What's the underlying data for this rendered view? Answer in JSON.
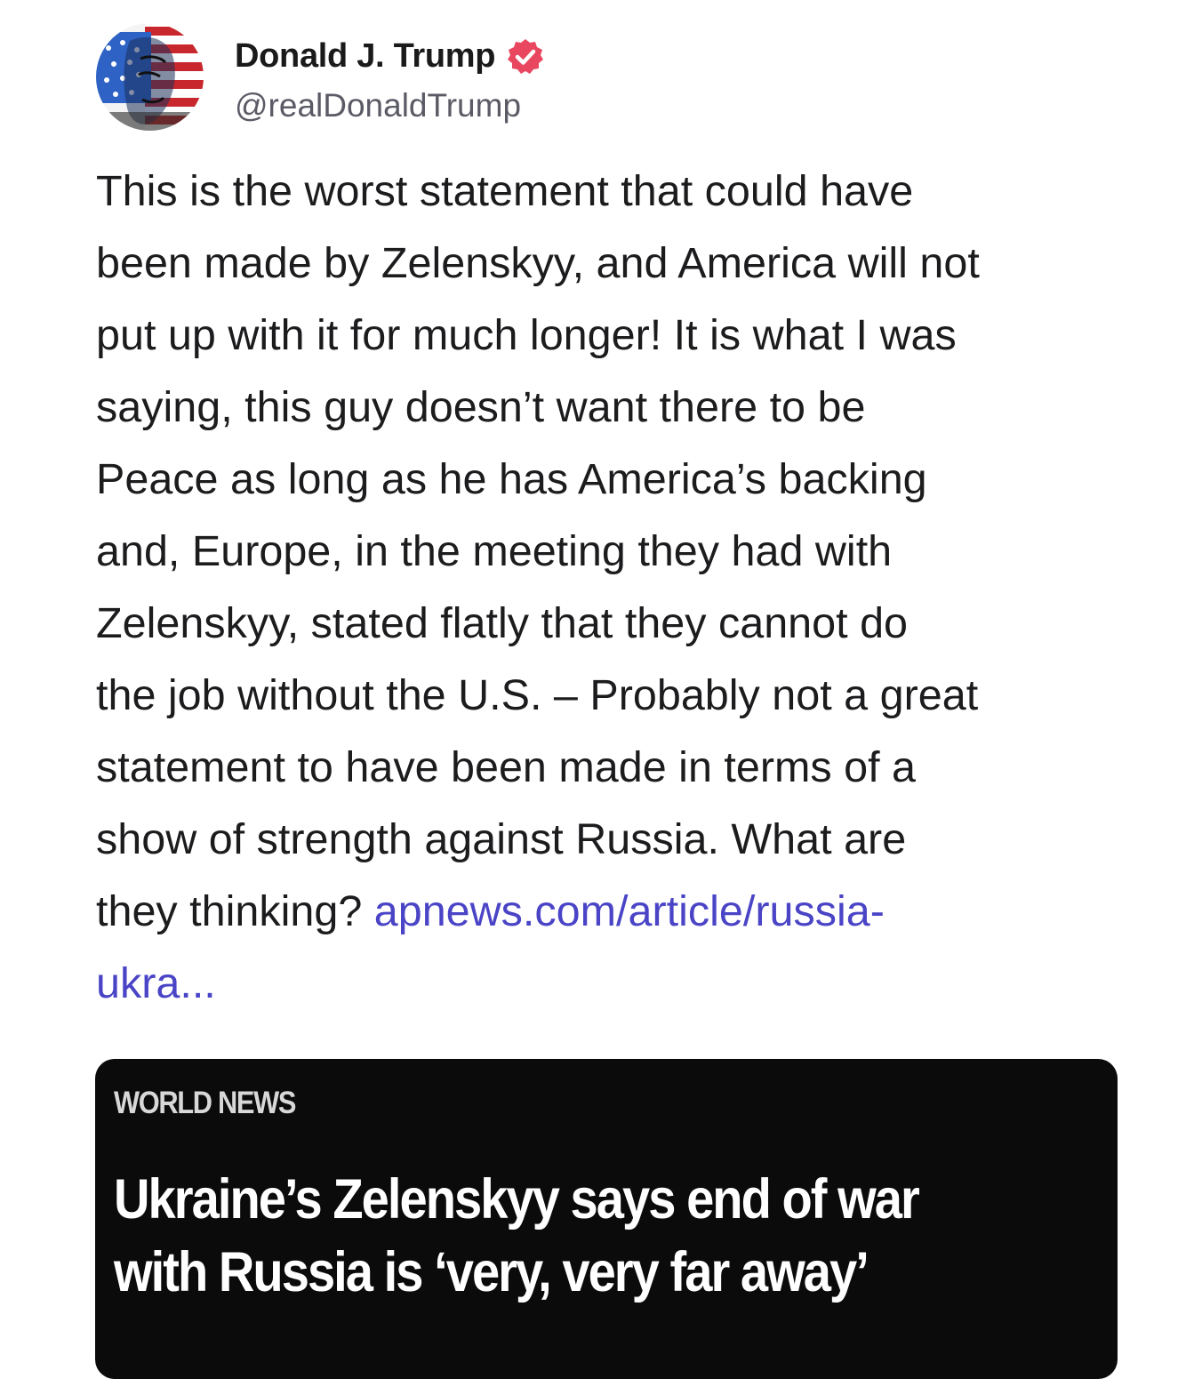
{
  "post": {
    "author": {
      "display_name": "Donald J. Trump",
      "handle": "@realDonaldTrump",
      "verified": true,
      "verified_icon": "verified-badge-icon",
      "verified_color": "#e8475f"
    },
    "text_lines": [
      "This is the worst statement that could have",
      "been made by Zelenskyy, and America will not",
      "put up with it for much longer! It is what I was",
      "saying, this guy doesn’t want there to be",
      "Peace as long as he has America’s backing",
      "and, Europe, in the meeting they had with",
      "Zelenskyy, stated flatly that they cannot do",
      "the job without the U.S. – Probably not a great",
      "statement to have been made in terms of a",
      "show of strength against Russia. What are",
      "they thinking? "
    ],
    "link": {
      "part1": "apnews.com/article/russia-",
      "part2": "ukra...",
      "color": "#4a44c6"
    },
    "card": {
      "kicker": "WORLD NEWS",
      "headline_line1": "Ukraine’s Zelenskyy says end of war",
      "headline_line2": "with Russia is ‘very, very far away’",
      "background": "#0b0b0b"
    }
  }
}
